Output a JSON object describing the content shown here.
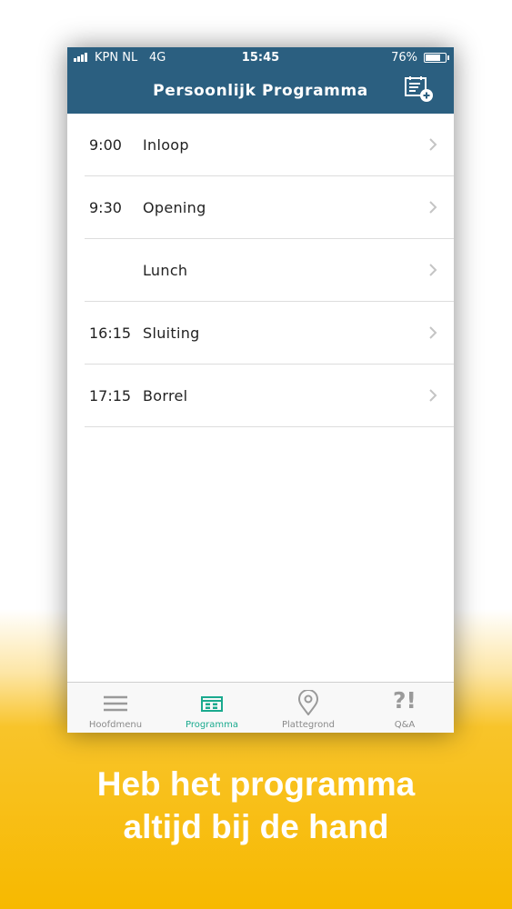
{
  "status_bar": {
    "carrier": "KPN NL",
    "network": "4G",
    "time": "15:45",
    "battery": "76%",
    "battery_level": 0.76
  },
  "header": {
    "title": "Persoonlijk Programma",
    "add_icon": "calendar-add-icon"
  },
  "program": [
    {
      "time": "9:00",
      "title": "Inloop"
    },
    {
      "time": "9:30",
      "title": "Opening"
    },
    {
      "time": "",
      "title": "Lunch"
    },
    {
      "time": "16:15",
      "title": "Sluiting"
    },
    {
      "time": "17:15",
      "title": "Borrel"
    }
  ],
  "tabs": [
    {
      "label": "Hoofdmenu",
      "icon": "menu-icon",
      "active": false
    },
    {
      "label": "Programma",
      "icon": "program-icon",
      "active": true
    },
    {
      "label": "Plattegrond",
      "icon": "map-pin-icon",
      "active": false
    },
    {
      "label": "Q&A",
      "icon": "qa-icon",
      "glyph": "?!",
      "active": false
    }
  ],
  "colors": {
    "header": "#2b5f80",
    "active_tab": "#1aaa8e",
    "inactive_tab": "#8a8a8a",
    "background_accent": "#f7b900"
  },
  "caption": {
    "line1": "Heb het programma",
    "line2": "altijd bij de hand"
  }
}
